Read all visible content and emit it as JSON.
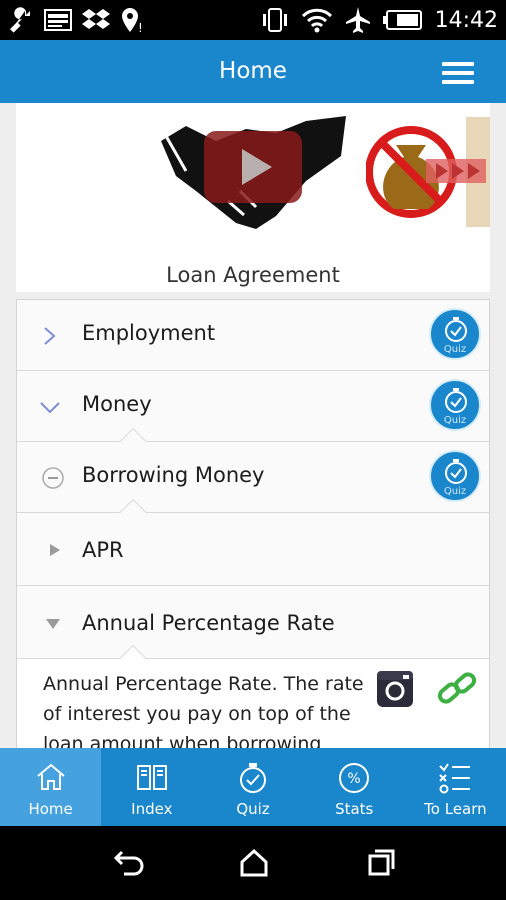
{
  "status_bar": {
    "time": "14:42",
    "icons": [
      "wrench-icon",
      "image-icon",
      "dropbox-icon",
      "location-icon",
      "vibrate-icon",
      "wifi-icon",
      "airplane-icon",
      "battery-icon"
    ]
  },
  "app_bar": {
    "title": "Home",
    "menu_icon": "hamburger-menu-icon"
  },
  "hero": {
    "caption": "Loan Agreement",
    "thumbnail_1": "handshake-video-thumbnail",
    "thumbnail_2": "money-bag-prohibited-thumbnail"
  },
  "list": {
    "rows": [
      {
        "label": "Employment",
        "icon": "chevron-right-icon",
        "quiz_label": "Quiz"
      },
      {
        "label": "Money",
        "icon": "chevron-down-icon",
        "quiz_label": "Quiz"
      },
      {
        "label": "Borrowing Money",
        "icon": "collapse-circle-icon",
        "quiz_label": "Quiz"
      },
      {
        "label": "APR",
        "icon": "triangle-right-icon"
      },
      {
        "label": "Annual Percentage Rate",
        "icon": "triangle-down-icon"
      }
    ],
    "description": "Annual Percentage Rate. The rate of interest you pay on top of the loan amount when borrowing"
  },
  "tab_bar": {
    "tabs": [
      {
        "label": "Home",
        "icon": "home-icon",
        "active": true
      },
      {
        "label": "Index",
        "icon": "book-icon",
        "active": false
      },
      {
        "label": "Quiz",
        "icon": "stopwatch-icon",
        "active": false
      },
      {
        "label": "Stats",
        "icon": "percent-icon",
        "active": false
      },
      {
        "label": "To Learn",
        "icon": "checklist-icon",
        "active": false
      }
    ]
  },
  "colors": {
    "primary": "#1a86cc",
    "active_tab": "#45a2de",
    "link_green": "#3cb043"
  }
}
